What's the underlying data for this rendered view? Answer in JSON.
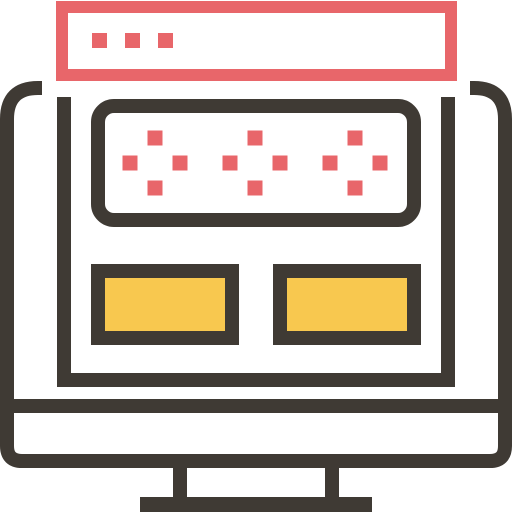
{
  "icon": {
    "name": "desktop-monitor-with-browser-window",
    "colors": {
      "outline": "#3f3a34",
      "accent_red": "#e8666a",
      "accent_yellow": "#f8c84f",
      "background": "#ffffff"
    },
    "browser_dots_count": 3,
    "dot_clusters_count": 3
  }
}
